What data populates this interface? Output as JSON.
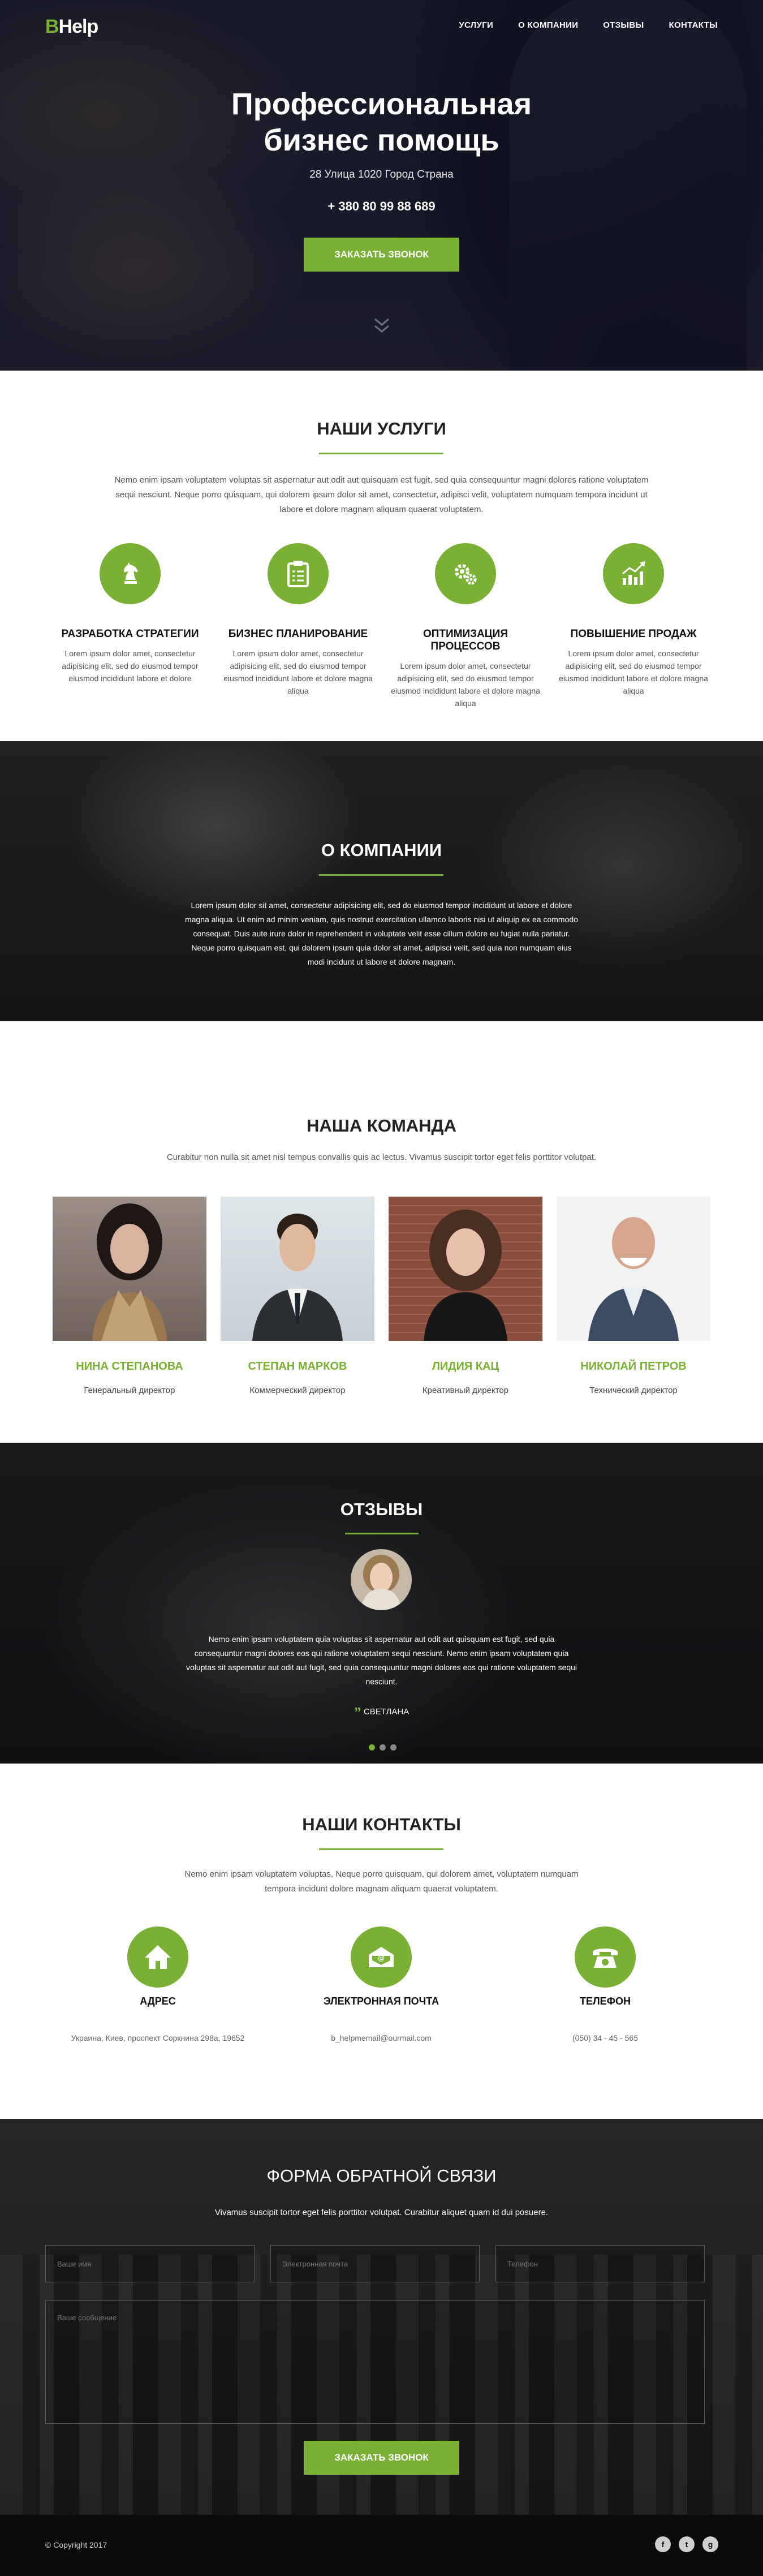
{
  "brand": {
    "letter": "B",
    "rest": "Help",
    "accent": "#7ab034"
  },
  "nav": [
    "УСЛУГИ",
    "О КОМПАНИИ",
    "ОТЗЫВЫ",
    "КОНТАКТЫ"
  ],
  "hero": {
    "title_line1": "Профессиональная",
    "title_line2": "бизнес помощь",
    "address": "28 Улица 1020 Город Страна",
    "phone": "+ 380 80 99 88 689",
    "cta": "ЗАКАЗАТЬ ЗВОНОК",
    "scroll_icon": "double-chevron-down-icon"
  },
  "services": {
    "title": "НАШИ УСЛУГИ",
    "intro": "Nemo enim ipsam voluptatem voluptas sit aspernatur aut odit aut quisquam est fugit, sed quia consequuntur magni dolores ratione voluptatem sequi nesciunt. Neque porro quisquam, qui dolorem ipsum dolor sit amet, consectetur, adipisci velit, voluptatem numquam tempora incidunt ut labore et dolore magnam aliquam quaerat voluptatem.",
    "items": [
      {
        "title": "РАЗРАБОТКА СТРАТЕГИИ",
        "icon": "chess-knight-icon",
        "text": "Lorem ipsum dolor amet, consectetur adipisicing elit, sed do eiusmod tempor eiusmod incididunt labore et dolore"
      },
      {
        "title": "БИЗНЕС ПЛАНИРОВАНИЕ",
        "icon": "clipboard-icon",
        "text": "Lorem ipsum dolor amet, consectetur adipisicing elit, sed do eiusmod tempor eiusmod incididunt labore et dolore magna aliqua"
      },
      {
        "title": "ОПТИМИЗАЦИЯ ПРОЦЕССОВ",
        "icon": "gears-icon",
        "text": "Lorem ipsum dolor amet, consectetur adipisicing elit, sed do eiusmod tempor eiusmod incididunt labore et dolore magna aliqua"
      },
      {
        "title": "ПОВЫШЕНИЕ ПРОДАЖ",
        "icon": "chart-growth-icon",
        "text": "Lorem ipsum dolor amet, consectetur adipisicing elit, sed do eiusmod tempor eiusmod incididunt labore et dolore magna aliqua"
      }
    ]
  },
  "about": {
    "title": "О КОМПАНИИ",
    "text": "Lorem ipsum dolor sit amet, consectetur adipisicing elit, sed do eiusmod tempor incididunt ut labore et dolore magna aliqua. Ut enim ad minim veniam, quis nostrud exercitation ullamco laboris nisi ut aliquip ex ea commodo consequat. Duis aute irure dolor in reprehenderit in voluptate velit esse cillum dolore eu fugiat nulla pariatur. Neque porro quisquam est, qui dolorem ipsum quia dolor sit amet, adipisci velit, sed quia non numquam eius modi incidunt ut labore et dolore magnam."
  },
  "team": {
    "title": "НАША КОМАНДА",
    "intro": "Curabitur non nulla sit amet nisl tempus convallis quis ac lectus. Vivamus suscipit tortor eget felis porttitor volutpat.",
    "members": [
      {
        "name": "НИНА СТЕПАНОВА",
        "role": "Генеральный директор"
      },
      {
        "name": "СТЕПАН МАРКОВ",
        "role": "Коммерческий директор"
      },
      {
        "name": "ЛИДИЯ КАЦ",
        "role": "Креативный директор"
      },
      {
        "name": "НИКОЛАЙ ПЕТРОВ",
        "role": "Технический директор"
      }
    ]
  },
  "reviews": {
    "title": "ОТЗЫВЫ",
    "text": "Nemo enim ipsam voluptatem quia voluptas sit aspernatur aut odit aut quisquam est fugit, sed quia consequuntur magni dolores eos qui ratione voluptatem sequi nesciunt. Nemo enim ipsam voluptatem quia voluptas sit aspernatur aut odit aut fugit, sed quia consequuntur magni dolores eos qui ratione voluptatem sequi nesciunt.",
    "quote_mark": "”",
    "author": "СВЕТЛАНА"
  },
  "contacts": {
    "title": "НАШИ КОНТАКТЫ",
    "intro": "Nemo enim ipsam voluptatem voluptas, Neque porro quisquam, qui dolorem amet, voluptatem numquam tempora incidunt dolore magnam aliquam quaerat voluptatem.",
    "items": [
      {
        "title": "АДРЕС",
        "icon": "home-icon",
        "value": "Украина, Киев, проспект Соркнина 298а, 19652"
      },
      {
        "title": "ЭЛЕКТРОННАЯ ПОЧТА",
        "icon": "mail-icon",
        "value": "b_helpmemail@ourmail.com"
      },
      {
        "title": "ТЕЛЕФОН",
        "icon": "phone-icon",
        "value": "(050) 34 - 45 - 565"
      }
    ]
  },
  "feedback": {
    "title": "ФОРМА ОБРАТНОЙ СВЯЗИ",
    "intro": "Vivamus suscipit tortor eget felis porttitor volutpat. Curabitur aliquet quam id dui posuere.",
    "name_ph": "Ваше имя",
    "email_ph": "Электронная почта",
    "phone_ph": "Телефон",
    "msg_ph": "Ваше сообщение",
    "submit": "ЗАКАЗАТЬ ЗВОНОК"
  },
  "footer": {
    "copyright": "© Copyright 2017",
    "social": [
      "f",
      "t",
      "g"
    ]
  }
}
